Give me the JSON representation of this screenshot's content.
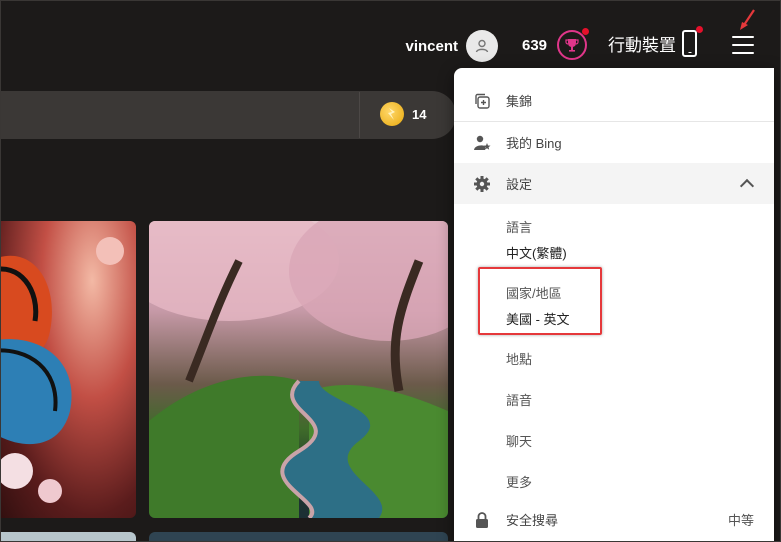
{
  "header": {
    "username": "vincent",
    "points": "639",
    "mobile_label": "行動裝置"
  },
  "search": {
    "rewards_count": "14"
  },
  "menu": {
    "collections": "集錦",
    "my_bing": "我的 Bing",
    "settings": "設定",
    "language_label": "語言",
    "language_value": "中文(繁體)",
    "region_label": "國家/地區",
    "region_value": "美國 - 英文",
    "location": "地點",
    "voice": "語音",
    "chat": "聊天",
    "more": "更多",
    "safe_search": "安全搜尋",
    "safe_search_value": "中等"
  },
  "colors": {
    "background": "#1c1a19",
    "accent_pink": "#e0368a",
    "notification_red": "#e5102b",
    "highlight_red": "#e5383b"
  }
}
